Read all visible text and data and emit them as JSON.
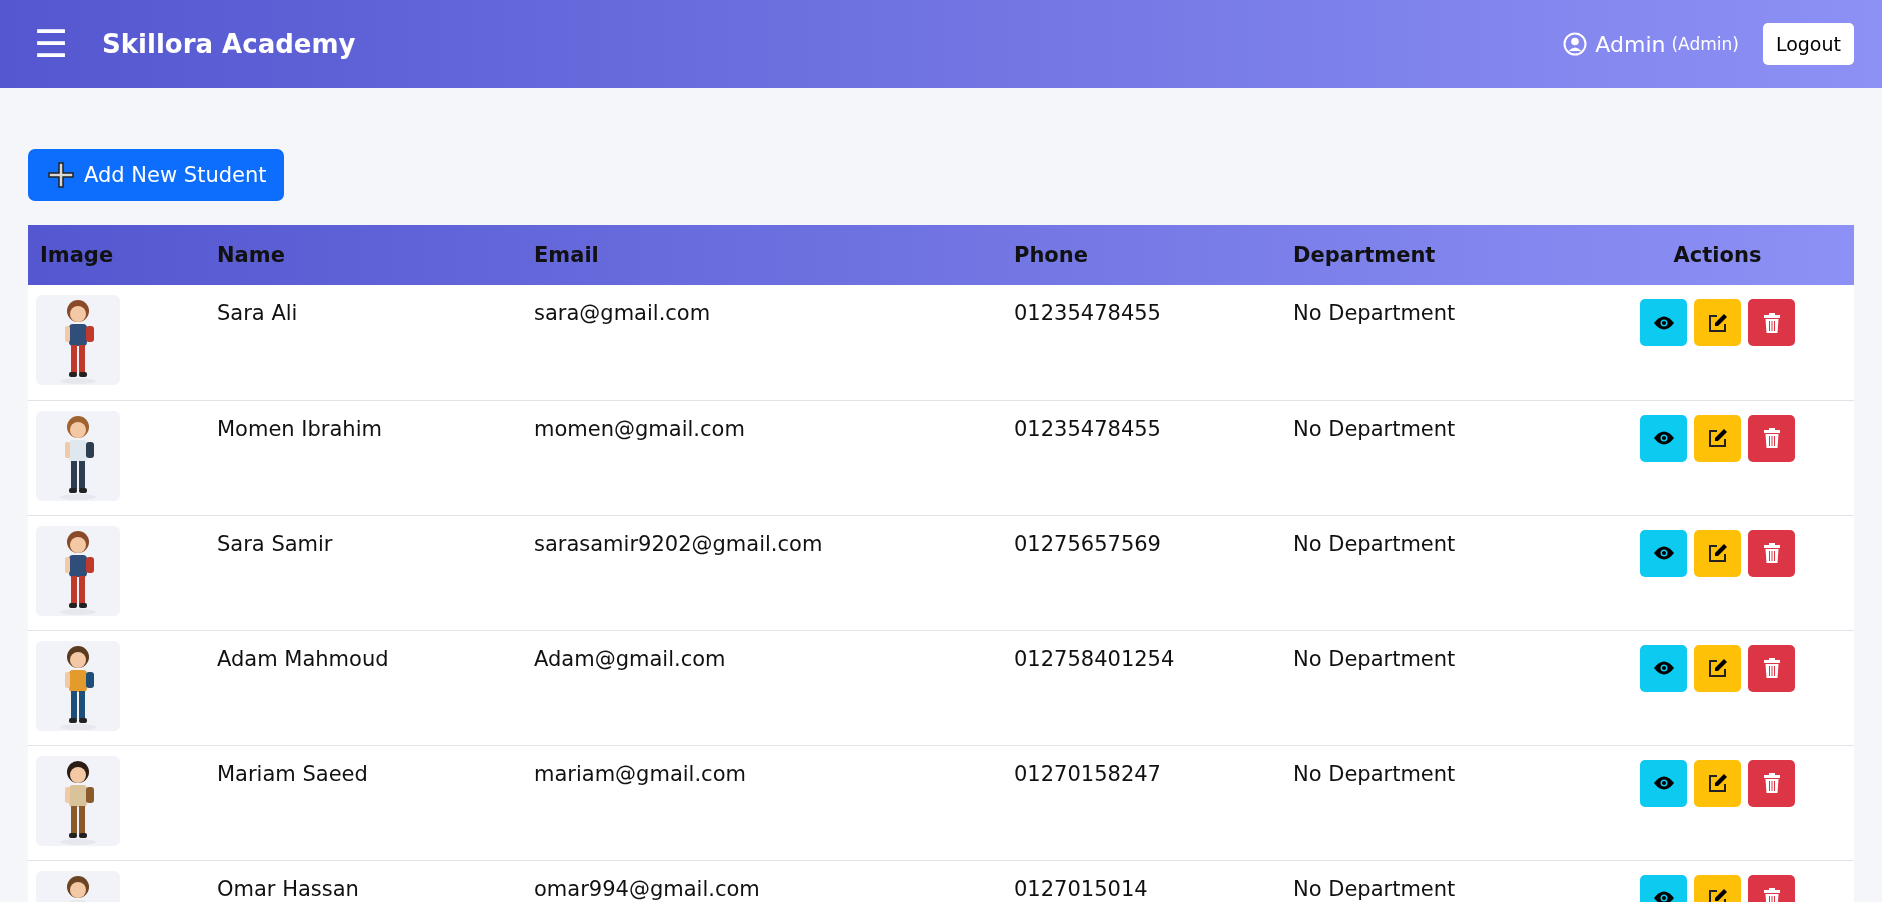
{
  "header": {
    "menu_icon": "☰",
    "title": "Skillora Academy",
    "user": "Admin",
    "role": "(Admin)",
    "logout": "Logout"
  },
  "add_button": "Add New Student",
  "table": {
    "columns": [
      "Image",
      "Name",
      "Email",
      "Phone",
      "Department",
      "Actions"
    ],
    "rows": [
      {
        "name": "Sara Ali",
        "email": "sara@gmail.com",
        "phone": "01235478455",
        "department": "No Department"
      },
      {
        "name": "Momen Ibrahim",
        "email": "momen@gmail.com",
        "phone": "01235478455",
        "department": "No Department"
      },
      {
        "name": "Sara Samir",
        "email": "sarasamir9202@gmail.com",
        "phone": "01275657569",
        "department": "No Department"
      },
      {
        "name": "Adam Mahmoud",
        "email": "Adam@gmail.com",
        "phone": "012758401254",
        "department": "No Department"
      },
      {
        "name": "Mariam Saeed",
        "email": "mariam@gmail.com",
        "phone": "01270158247",
        "department": "No Department"
      },
      {
        "name": "Omar Hassan",
        "email": "omar994@gmail.com",
        "phone": "0127015014",
        "department": "No Department"
      }
    ]
  }
}
